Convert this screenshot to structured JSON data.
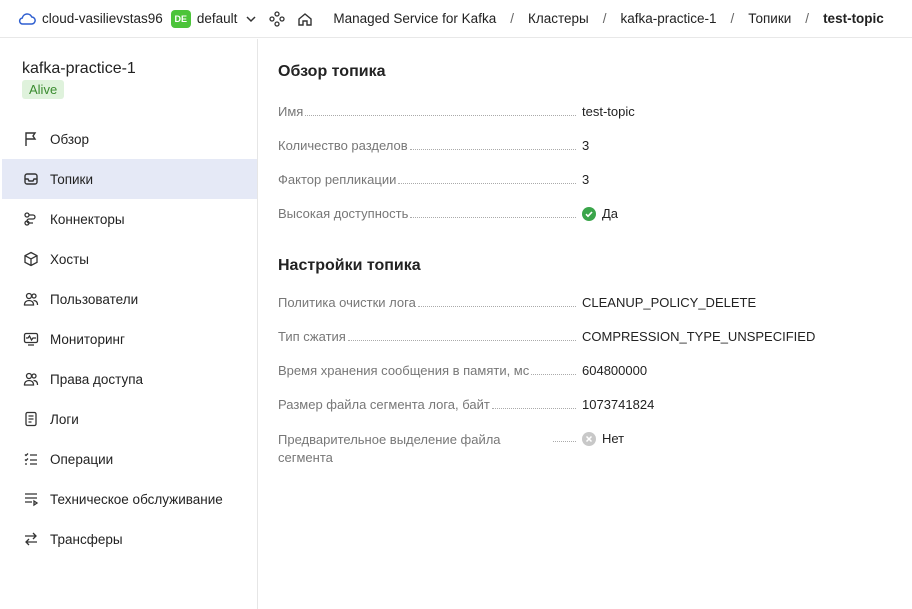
{
  "topbar": {
    "cloud_name": "cloud-vasilievstas96",
    "folder_badge": "DE",
    "folder_name": "default",
    "breadcrumbs": [
      "Managed Service for Kafka",
      "Кластеры",
      "kafka-practice-1",
      "Топики",
      "test-topic"
    ]
  },
  "sidebar": {
    "title": "kafka-practice-1",
    "status": "Alive",
    "items": [
      {
        "label": "Обзор",
        "icon": "flag-icon"
      },
      {
        "label": "Топики",
        "icon": "inbox-icon",
        "active": true
      },
      {
        "label": "Коннекторы",
        "icon": "connector-icon"
      },
      {
        "label": "Хосты",
        "icon": "cube-icon"
      },
      {
        "label": "Пользователи",
        "icon": "users-icon"
      },
      {
        "label": "Мониторинг",
        "icon": "monitor-icon"
      },
      {
        "label": "Права доступа",
        "icon": "users-access-icon"
      },
      {
        "label": "Логи",
        "icon": "logs-icon"
      },
      {
        "label": "Операции",
        "icon": "operations-icon"
      },
      {
        "label": "Техническое обслуживание",
        "icon": "maintenance-icon"
      },
      {
        "label": "Трансферы",
        "icon": "transfer-icon"
      }
    ]
  },
  "overview": {
    "title": "Обзор топика",
    "rows": [
      {
        "key": "Имя",
        "value": "test-topic"
      },
      {
        "key": "Количество разделов",
        "value": "3"
      },
      {
        "key": "Фактор репликации",
        "value": "3"
      },
      {
        "key": "Высокая доступность",
        "value": "Да"
      }
    ]
  },
  "settings": {
    "title": "Настройки топика",
    "rows": [
      {
        "key": "Политика очистки лога",
        "value": "CLEANUP_POLICY_DELETE"
      },
      {
        "key": "Тип сжатия",
        "value": "COMPRESSION_TYPE_UNSPECIFIED"
      },
      {
        "key": "Время хранения сообщения в памяти, мс",
        "value": "604800000"
      },
      {
        "key": "Размер файла сегмента лога, байт",
        "value": "1073741824"
      },
      {
        "key_line1": "Предварительное выделение файла",
        "key_line2": "сегмента",
        "value": "Нет"
      }
    ]
  },
  "colors": {
    "accent_active_bg": "#e5e9f6",
    "status_green": "#3aa54a",
    "badge_green": "#4cc43a",
    "alive_bg": "#dff2dc",
    "alive_text": "#3a8b2f"
  }
}
